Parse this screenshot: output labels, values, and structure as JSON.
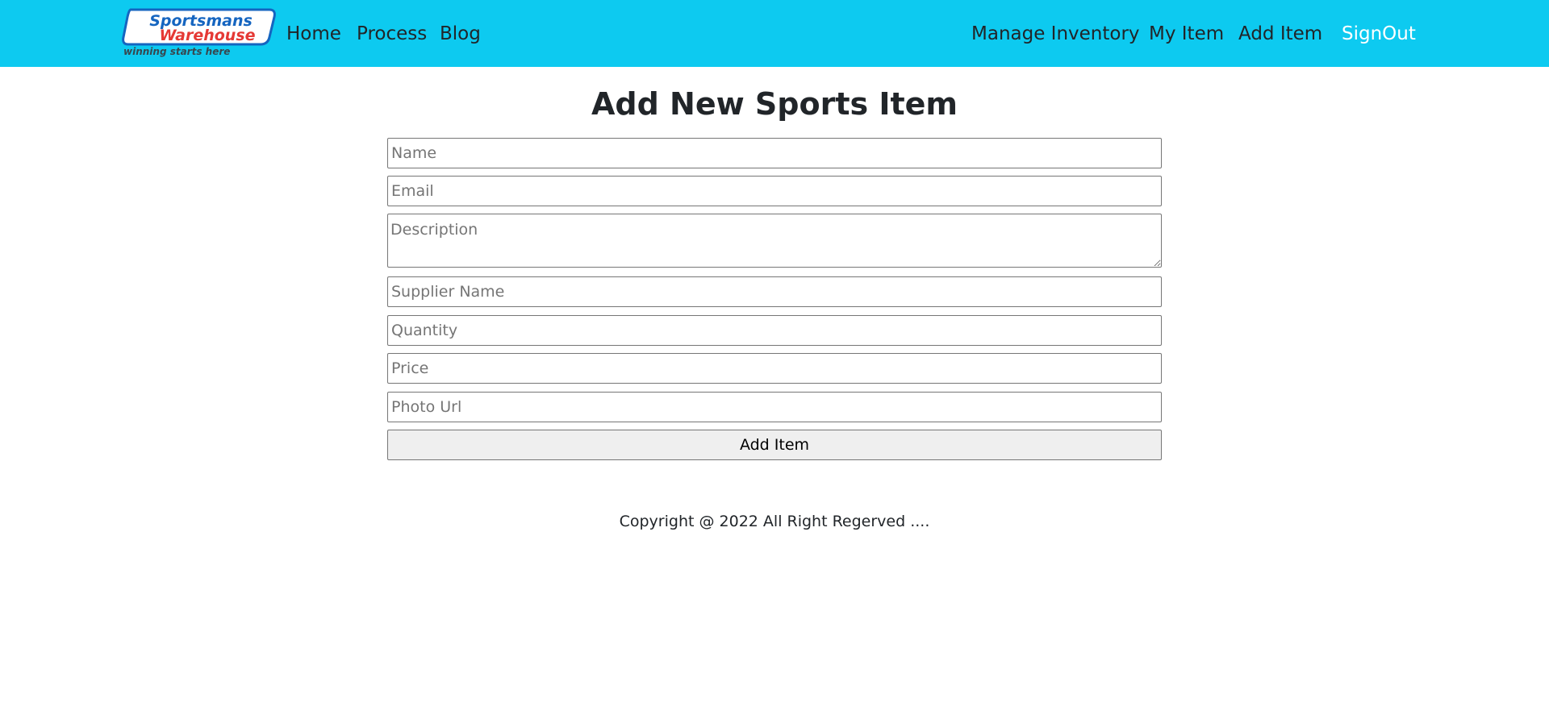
{
  "nav": {
    "brand": {
      "name_top": "Sportsmans",
      "name_bottom": "Warehouse",
      "tagline": "winning starts here",
      "colors": {
        "blue": "#1565c0",
        "red": "#e53935",
        "text_dark": "#37474f"
      }
    },
    "left_links": [
      "Home",
      "Process",
      "Blog"
    ],
    "right_links": [
      "Manage Inventory",
      "My Item",
      "Add Item"
    ],
    "signout": "SignOut",
    "background": "#0dcaf0"
  },
  "form": {
    "title": "Add New Sports Item",
    "fields": {
      "name": {
        "placeholder": "Name",
        "value": ""
      },
      "email": {
        "placeholder": "Email",
        "value": ""
      },
      "description": {
        "placeholder": "Description",
        "value": ""
      },
      "supplier": {
        "placeholder": "Supplier Name",
        "value": ""
      },
      "quantity": {
        "placeholder": "Quantity",
        "value": ""
      },
      "price": {
        "placeholder": "Price",
        "value": ""
      },
      "photo": {
        "placeholder": "Photo Url",
        "value": ""
      }
    },
    "submit_label": "Add Item"
  },
  "footer": {
    "text": "Copyright @ 2022 All Right Regerved ...."
  }
}
